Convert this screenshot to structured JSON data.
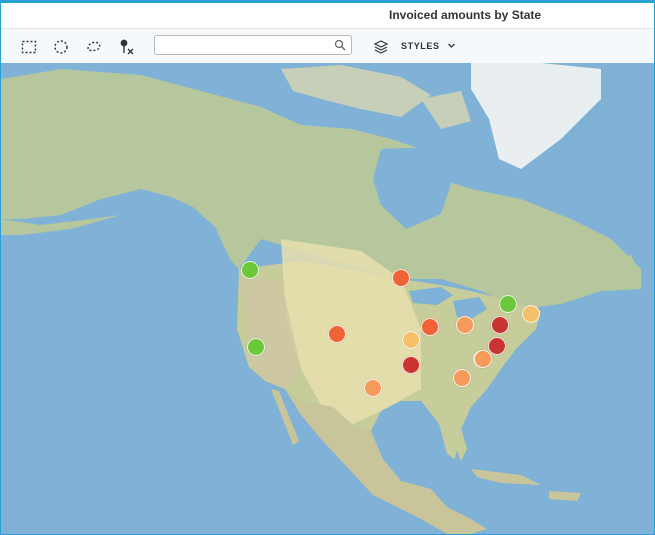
{
  "title": "Invoiced amounts by State",
  "toolbar": {
    "search_value": "",
    "styles_label": "STYLES"
  },
  "colors": {
    "green": "#6cc83a",
    "light_orange": "#f5c06a",
    "orange": "#f59a58",
    "red_orange": "#ee6236",
    "red": "#c93331",
    "water": "#7fb2d6",
    "land": "#b9c9a2",
    "arid": "#e8dfae"
  },
  "markers": [
    {
      "color": "green"
    },
    {
      "color": "green"
    },
    {
      "color": "red_orange"
    },
    {
      "color": "red_orange"
    },
    {
      "color": "red_orange"
    },
    {
      "color": "orange"
    },
    {
      "color": "orange"
    },
    {
      "color": "orange"
    },
    {
      "color": "light_orange"
    },
    {
      "color": "red"
    },
    {
      "color": "green"
    },
    {
      "color": "light_orange"
    },
    {
      "color": "red"
    },
    {
      "color": "red"
    },
    {
      "color": "light_orange"
    },
    {
      "color": "orange"
    }
  ]
}
